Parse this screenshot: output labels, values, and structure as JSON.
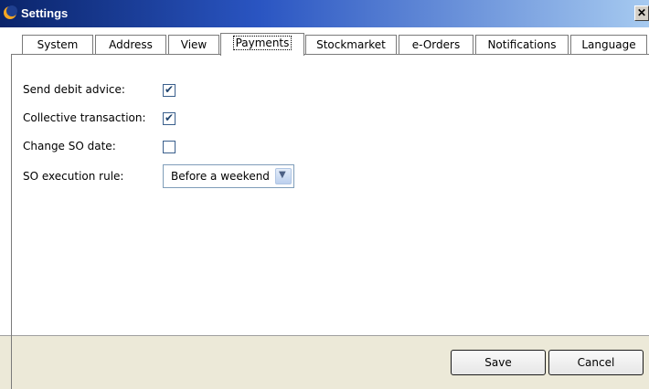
{
  "window": {
    "title": "Settings",
    "close_glyph": "✕"
  },
  "tabs": [
    {
      "label": "System"
    },
    {
      "label": "Address"
    },
    {
      "label": "View"
    },
    {
      "label": "Payments",
      "active": true
    },
    {
      "label": "Stockmarket"
    },
    {
      "label": "e-Orders"
    },
    {
      "label": "Notifications"
    },
    {
      "label": "Language"
    }
  ],
  "payments": {
    "send_debit_advice": {
      "label": "Send debit advice:",
      "checked": true
    },
    "collective_transaction": {
      "label": "Collective transaction:",
      "checked": true
    },
    "change_so_date": {
      "label": "Change SO date:",
      "checked": false
    },
    "so_execution_rule": {
      "label": "SO execution rule:",
      "value": "Before a weekend"
    }
  },
  "buttons": {
    "save": "Save",
    "cancel": "Cancel"
  },
  "colors": {
    "titlebar_start": "#0a246a",
    "titlebar_end": "#a6caf0",
    "checkmark": "#21456f"
  },
  "icons": {
    "app": "app-moon-icon",
    "dropdown": "chevron-down-icon",
    "check": "check-icon"
  }
}
